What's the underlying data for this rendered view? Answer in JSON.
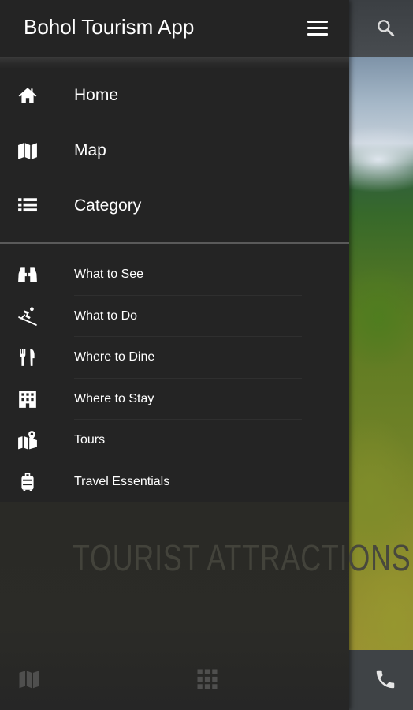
{
  "app": {
    "title": "Bohol Tourism App"
  },
  "hero": {
    "banner_text": "TOURIST ATTRACTIONS"
  },
  "drawer": {
    "main_items": [
      {
        "label": "Home",
        "icon": "home-icon"
      },
      {
        "label": "Map",
        "icon": "map-icon"
      },
      {
        "label": "Category",
        "icon": "list-icon"
      }
    ],
    "sub_items": [
      {
        "label": "What to See",
        "icon": "binoculars-icon"
      },
      {
        "label": "What to Do",
        "icon": "skiing-icon"
      },
      {
        "label": "Where to Dine",
        "icon": "fork-knife-icon"
      },
      {
        "label": "Where to Stay",
        "icon": "building-icon"
      },
      {
        "label": "Tours",
        "icon": "map-marker-icon"
      },
      {
        "label": "Travel Essentials",
        "icon": "luggage-icon"
      }
    ]
  },
  "bottom_bar": {
    "icons": [
      "map-icon",
      "grid-icon",
      "phone-icon"
    ]
  },
  "colors": {
    "drawer_bg": "#242424",
    "text": "#ffffff",
    "app_bar": "#44484c"
  }
}
